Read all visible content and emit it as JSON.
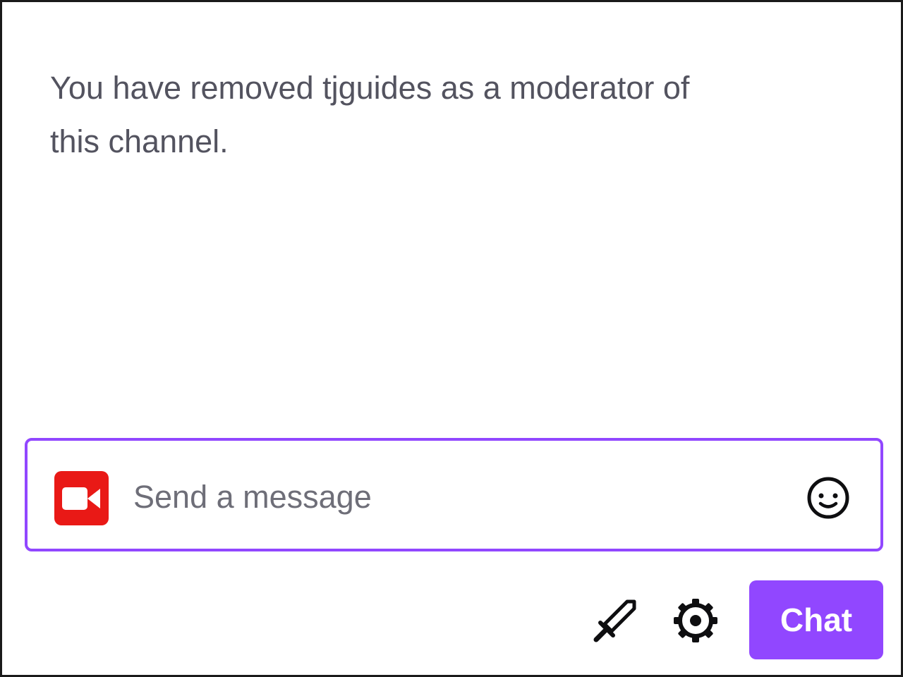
{
  "chat": {
    "system_message_line1": "You have removed tjguides as a moderator of",
    "system_message_line2": "this channel."
  },
  "input": {
    "placeholder": "Send a message",
    "value": ""
  },
  "controls": {
    "chat_button_label": "Chat"
  },
  "icons": {
    "badge": "video-camera-icon",
    "emote": "smiley-icon",
    "moderation": "sword-icon",
    "settings": "gear-icon"
  },
  "colors": {
    "accent": "#9147ff",
    "badge_red": "#e91916",
    "message_text": "#53535f"
  }
}
